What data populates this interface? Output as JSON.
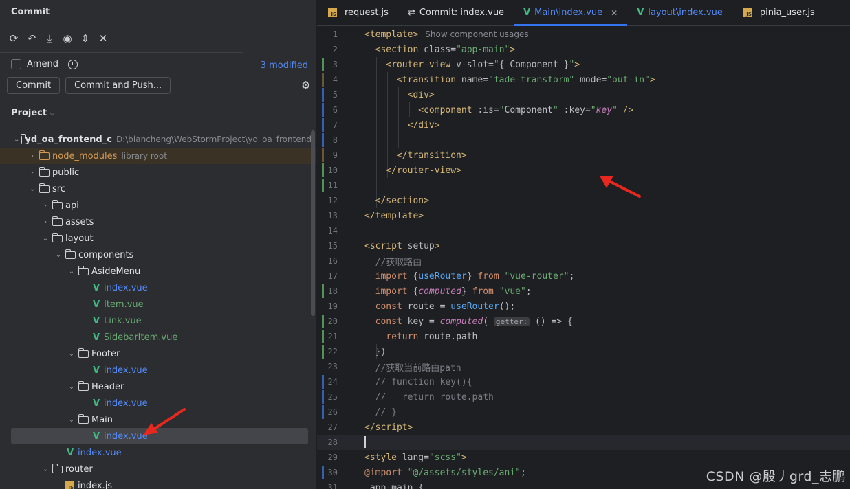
{
  "commit": {
    "title": "Commit",
    "amend_label": "Amend",
    "modified": "3 modified",
    "commit_button": "Commit",
    "commit_push_button": "Commit and Push..."
  },
  "project": {
    "title": "Project",
    "tree": [
      {
        "depth": 0,
        "type": "folder",
        "expanded": true,
        "label": "yd_oa_frontend_c",
        "bold": true,
        "path": "D:\\biancheng\\WebStormProject\\yd_oa_frontend_c"
      },
      {
        "depth": 1,
        "type": "folder",
        "expanded": false,
        "label": "node_modules",
        "style": "lib",
        "path": "library root"
      },
      {
        "depth": 1,
        "type": "folder",
        "expanded": false,
        "label": "public"
      },
      {
        "depth": 1,
        "type": "folder",
        "expanded": true,
        "label": "src"
      },
      {
        "depth": 2,
        "type": "folder",
        "expanded": false,
        "label": "api"
      },
      {
        "depth": 2,
        "type": "folder",
        "expanded": false,
        "label": "assets"
      },
      {
        "depth": 2,
        "type": "folder",
        "expanded": true,
        "label": "layout"
      },
      {
        "depth": 3,
        "type": "folder",
        "expanded": true,
        "label": "components"
      },
      {
        "depth": 4,
        "type": "folder",
        "expanded": true,
        "label": "AsideMenu"
      },
      {
        "depth": 5,
        "type": "vue",
        "label": "index.vue",
        "style": "vue"
      },
      {
        "depth": 5,
        "type": "vue",
        "label": "Item.vue",
        "style": "green"
      },
      {
        "depth": 5,
        "type": "vue",
        "label": "Link.vue",
        "style": "green"
      },
      {
        "depth": 5,
        "type": "vue",
        "label": "SidebarItem.vue",
        "style": "green"
      },
      {
        "depth": 4,
        "type": "folder",
        "expanded": true,
        "label": "Footer"
      },
      {
        "depth": 5,
        "type": "vue",
        "label": "index.vue",
        "style": "vue"
      },
      {
        "depth": 4,
        "type": "folder",
        "expanded": true,
        "label": "Header"
      },
      {
        "depth": 5,
        "type": "vue",
        "label": "index.vue",
        "style": "vue"
      },
      {
        "depth": 4,
        "type": "folder",
        "expanded": true,
        "label": "Main"
      },
      {
        "depth": 5,
        "type": "vue",
        "label": "index.vue",
        "style": "vue",
        "selected": true
      },
      {
        "depth": 3,
        "type": "vue",
        "label": "index.vue",
        "style": "vue"
      },
      {
        "depth": 2,
        "type": "folder",
        "expanded": true,
        "label": "router"
      },
      {
        "depth": 3,
        "type": "js",
        "label": "index.js"
      }
    ]
  },
  "tabs": [
    {
      "icon": "js",
      "label": "request.js"
    },
    {
      "icon": "diff",
      "label": "Commit: index.vue"
    },
    {
      "icon": "vue",
      "label": "Main\\index.vue",
      "active": true,
      "closable": true
    },
    {
      "icon": "vue",
      "label": "layout\\index.vue",
      "style": "vue"
    },
    {
      "icon": "js",
      "label": "pinia_user.js"
    }
  ],
  "editor": {
    "hint_text": "Show component usages",
    "inlay_getter": "getter:",
    "lines": [
      {
        "n": "1",
        "mark": "",
        "html": "<span class=\"tag\">&lt;template&gt;</span>",
        "hint": true
      },
      {
        "n": "2",
        "mark": "",
        "html": "  <span class=\"tag\">&lt;section</span> <span class=\"attr\">class</span>=<span class=\"str\">\"app-main\"</span><span class=\"tag\">&gt;</span>"
      },
      {
        "n": "3",
        "mark": "green",
        "html": "    <span class=\"tag\">&lt;router-view</span> <span class=\"attr\">v-slot</span>=<span class=\"str\">\"</span>{ Component }<span class=\"str\">\"</span><span class=\"tag\">&gt;</span>"
      },
      {
        "n": "4",
        "mark": "brown",
        "html": "      <span class=\"tag\">&lt;transition</span> <span class=\"attr\">name</span>=<span class=\"str\">\"fade-transform\"</span> <span class=\"attr\">mode</span>=<span class=\"str\">\"out-in\"</span><span class=\"tag\">&gt;</span>"
      },
      {
        "n": "5",
        "mark": "blue",
        "html": "        <span class=\"tag\">&lt;div&gt;</span>"
      },
      {
        "n": "6",
        "mark": "blue",
        "html": "          <span class=\"tag\">&lt;component</span> <span class=\"attr\">:is</span>=<span class=\"str\">\"</span>Component<span class=\"str\">\"</span> <span class=\"attr\">:key</span>=<span class=\"str\">\"</span><span class=\"it\">key</span><span class=\"str\">\"</span> <span class=\"tag\">/&gt;</span>"
      },
      {
        "n": "7",
        "mark": "blue",
        "html": "        <span class=\"tag\">&lt;/div&gt;</span>"
      },
      {
        "n": "8",
        "mark": "blue",
        "html": ""
      },
      {
        "n": "9",
        "mark": "brown",
        "html": "      <span class=\"tag\">&lt;/transition&gt;</span>"
      },
      {
        "n": "10",
        "mark": "green",
        "html": "    <span class=\"tag\">&lt;/router-view&gt;</span>"
      },
      {
        "n": "11",
        "mark": "green",
        "html": ""
      },
      {
        "n": "12",
        "mark": "",
        "html": "  <span class=\"tag\">&lt;/section&gt;</span>"
      },
      {
        "n": "13",
        "mark": "",
        "html": "<span class=\"tag\">&lt;/template&gt;</span>"
      },
      {
        "n": "14",
        "mark": "",
        "html": ""
      },
      {
        "n": "15",
        "mark": "",
        "html": "<span class=\"tag\">&lt;script</span> <span class=\"attr\">setup</span><span class=\"tag\">&gt;</span>"
      },
      {
        "n": "16",
        "mark": "",
        "html": "  <span class=\"cm\">//获取路由</span>"
      },
      {
        "n": "17",
        "mark": "",
        "html": "  <span class=\"kw\">import</span> {<span class=\"fn\">useRouter</span>} <span class=\"kw\">from</span> <span class=\"str\">\"vue-router\"</span>;"
      },
      {
        "n": "18",
        "mark": "green",
        "html": "  <span class=\"kw\">import</span> {<span class=\"it\">computed</span>} <span class=\"kw\">from</span> <span class=\"str\">\"vue\"</span>;"
      },
      {
        "n": "19",
        "mark": "",
        "html": "  <span class=\"kw\">const</span> route = <span class=\"fn\">useRouter</span>();"
      },
      {
        "n": "20",
        "mark": "green",
        "html": "  <span class=\"kw\">const</span> key = <span class=\"it\">computed</span>( <span class=\"inlay\">getter:</span> () =&gt; {"
      },
      {
        "n": "21",
        "mark": "green",
        "html": "    <span class=\"kw\">return</span> route.path"
      },
      {
        "n": "22",
        "mark": "green",
        "html": "  })"
      },
      {
        "n": "23",
        "mark": "",
        "html": "  <span class=\"cm\">//获取当前路由path</span>"
      },
      {
        "n": "24",
        "mark": "blue",
        "html": "  <span class=\"cm\">// function key(){</span>"
      },
      {
        "n": "25",
        "mark": "blue",
        "html": "  <span class=\"cm\">//   return route.path</span>"
      },
      {
        "n": "26",
        "mark": "blue",
        "html": "  <span class=\"cm\">// }</span>"
      },
      {
        "n": "27",
        "mark": "",
        "html": "<span class=\"tag\">&lt;/script&gt;</span>"
      },
      {
        "n": "28",
        "mark": "",
        "html": "<span class=\"caret\"></span>",
        "current": true
      },
      {
        "n": "29",
        "mark": "",
        "html": "<span class=\"tag\">&lt;style</span> <span class=\"attr\">lang</span>=<span class=\"str\">\"scss\"</span><span class=\"tag\">&gt;</span>"
      },
      {
        "n": "30",
        "mark": "blue",
        "html": "<span class=\"kw\">@import</span> <span class=\"str\">\"@/assets/styles/ani\"</span>;"
      },
      {
        "n": "31",
        "mark": "",
        "html": ".app-main {"
      }
    ]
  },
  "watermark": "CSDN @殷丿grd_志鹏"
}
